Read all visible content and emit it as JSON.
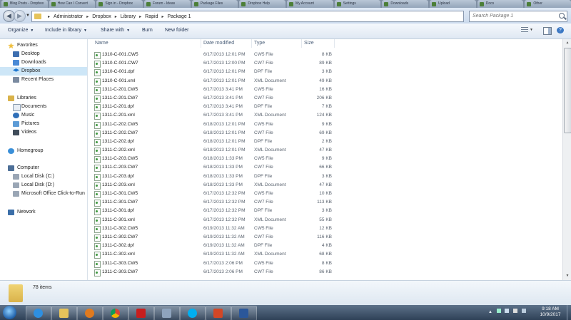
{
  "window": {
    "browser_tabs": [
      "Blog Posts - Dropbox",
      "How Can I Convert",
      "Sign in - Dropbox",
      "Forum - Ideas",
      "Package Files",
      "Dropbox Help",
      "My Account",
      "Settings",
      "Downloads",
      "Upload",
      "Docs",
      "Other"
    ]
  },
  "addressbar": {
    "breadcrumbs": [
      "Administrator",
      "Dropbox",
      "Library",
      "Rapid",
      "Package 1"
    ],
    "search_placeholder": "Search Package 1"
  },
  "toolbar": {
    "organize": "Organize",
    "include_in_library": "Include in library",
    "share_with": "Share with",
    "burn": "Burn",
    "new_folder": "New folder"
  },
  "navpane": {
    "favorites": "Favorites",
    "desktop": "Desktop",
    "downloads": "Downloads",
    "dropbox": "Dropbox",
    "recent_places": "Recent Places",
    "libraries": "Libraries",
    "documents": "Documents",
    "music": "Music",
    "pictures": "Pictures",
    "videos": "Videos",
    "homegroup": "Homegroup",
    "computer": "Computer",
    "local_c": "Local Disk (C:)",
    "local_d": "Local Disk (D:)",
    "ms_office": "Microsoft Office Click-to-Run",
    "network": "Network"
  },
  "columns": {
    "name": "Name",
    "date": "Date modified",
    "type": "Type",
    "size": "Size"
  },
  "files": [
    {
      "name": "1310-C-001.CW5",
      "date": "6/17/2013 12:01 PM",
      "type": "CW5 File",
      "size": "8 KB"
    },
    {
      "name": "1310-C-001.CW7",
      "date": "6/17/2013 12:00 PM",
      "type": "CW7 File",
      "size": "89 KB"
    },
    {
      "name": "1310-C-001.dpf",
      "date": "6/17/2013 12:01 PM",
      "type": "DPF File",
      "size": "3 KB"
    },
    {
      "name": "1310-C-001.xml",
      "date": "6/17/2013 12:01 PM",
      "type": "XML Document",
      "size": "49 KB"
    },
    {
      "name": "1311-C-201.CW5",
      "date": "6/17/2013 3:41 PM",
      "type": "CW5 File",
      "size": "16 KB"
    },
    {
      "name": "1311-C-201.CW7",
      "date": "6/17/2013 3:41 PM",
      "type": "CW7 File",
      "size": "206 KB"
    },
    {
      "name": "1311-C-201.dpf",
      "date": "6/17/2013 3:41 PM",
      "type": "DPF File",
      "size": "7 KB"
    },
    {
      "name": "1311-C-201.xml",
      "date": "6/17/2013 3:41 PM",
      "type": "XML Document",
      "size": "124 KB"
    },
    {
      "name": "1311-C-202.CW5",
      "date": "6/18/2013 12:01 PM",
      "type": "CW5 File",
      "size": "9 KB"
    },
    {
      "name": "1311-C-202.CW7",
      "date": "6/18/2013 12:01 PM",
      "type": "CW7 File",
      "size": "69 KB"
    },
    {
      "name": "1311-C-202.dpf",
      "date": "6/18/2013 12:01 PM",
      "type": "DPF File",
      "size": "2 KB"
    },
    {
      "name": "1311-C-202.xml",
      "date": "6/18/2013 12:01 PM",
      "type": "XML Document",
      "size": "47 KB"
    },
    {
      "name": "1311-C-203.CW5",
      "date": "6/18/2013 1:33 PM",
      "type": "CW5 File",
      "size": "9 KB"
    },
    {
      "name": "1311-C-203.CW7",
      "date": "6/18/2013 1:33 PM",
      "type": "CW7 File",
      "size": "66 KB"
    },
    {
      "name": "1311-C-203.dpf",
      "date": "6/18/2013 1:33 PM",
      "type": "DPF File",
      "size": "3 KB"
    },
    {
      "name": "1311-C-203.xml",
      "date": "6/18/2013 1:33 PM",
      "type": "XML Document",
      "size": "47 KB"
    },
    {
      "name": "1311-C-301.CW5",
      "date": "6/17/2013 12:32 PM",
      "type": "CW5 File",
      "size": "10 KB"
    },
    {
      "name": "1311-C-301.CW7",
      "date": "6/17/2013 12:32 PM",
      "type": "CW7 File",
      "size": "113 KB"
    },
    {
      "name": "1311-C-301.dpf",
      "date": "6/17/2013 12:32 PM",
      "type": "DPF File",
      "size": "3 KB"
    },
    {
      "name": "1311-C-301.xml",
      "date": "6/17/2013 12:32 PM",
      "type": "XML Document",
      "size": "55 KB"
    },
    {
      "name": "1311-C-302.CW5",
      "date": "6/19/2013 11:32 AM",
      "type": "CW5 File",
      "size": "12 KB"
    },
    {
      "name": "1311-C-302.CW7",
      "date": "6/19/2013 11:32 AM",
      "type": "CW7 File",
      "size": "116 KB"
    },
    {
      "name": "1311-C-302.dpf",
      "date": "6/19/2013 11:32 AM",
      "type": "DPF File",
      "size": "4 KB"
    },
    {
      "name": "1311-C-302.xml",
      "date": "6/19/2013 11:32 AM",
      "type": "XML Document",
      "size": "68 KB"
    },
    {
      "name": "1311-C-303.CW5",
      "date": "6/17/2013 2:06 PM",
      "type": "CW5 File",
      "size": "8 KB"
    },
    {
      "name": "1311-C-303.CW7",
      "date": "6/17/2013 2:06 PM",
      "type": "CW7 File",
      "size": "86 KB"
    }
  ],
  "details": {
    "item_count": "78 items"
  },
  "taskbar": {
    "time": "9:18 AM",
    "date": "10/9/2017"
  },
  "colors": {
    "selection": "#cde6f7",
    "link_text": "#1e3050",
    "taskbar": "#2f4157"
  }
}
